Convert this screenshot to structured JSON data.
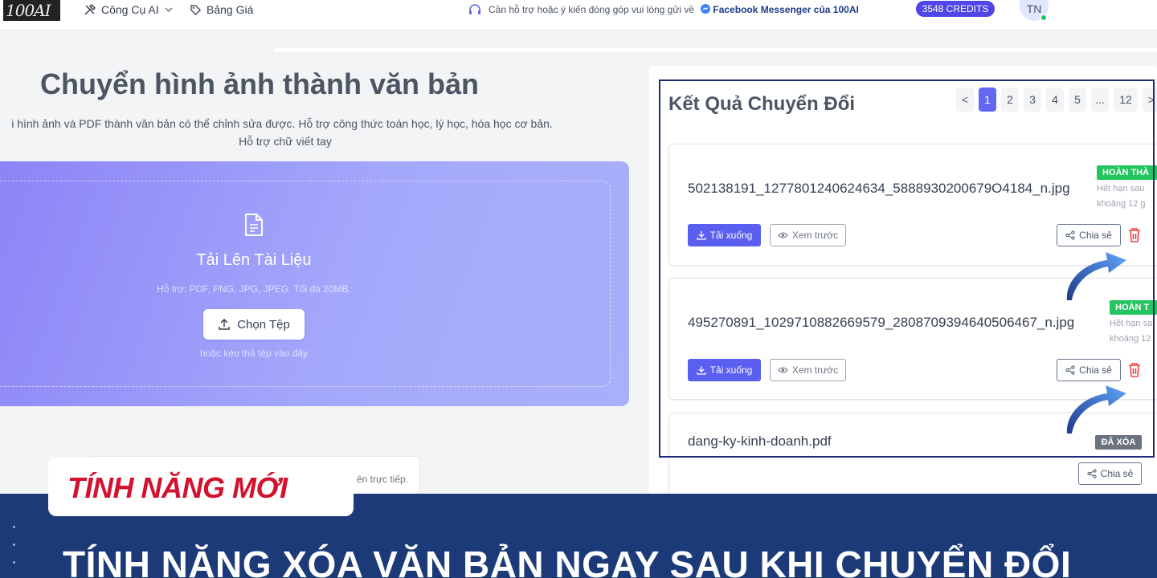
{
  "header": {
    "logo_text": "100AI",
    "nav": [
      {
        "label": "Công Cụ AI",
        "icon": "tools-icon",
        "has_dropdown": true
      },
      {
        "label": "Bảng Giá",
        "icon": "tag-icon"
      }
    ],
    "support_text": "Cần hỗ trợ hoặc ý kiến đóng góp vui lòng gửi về",
    "support_link": "Facebook Messenger của 100AI",
    "credits": "3548 CREDITS",
    "avatar_initials": "TN"
  },
  "main": {
    "title": "Chuyển hình ảnh thành văn bản",
    "subtitle_line1": "i hình ảnh và PDF thành văn bản có thể chỉnh sửa được. Hỗ trợ công thức toán học, lý học, hóa học cơ bản.",
    "subtitle_line2": "Hỗ trợ chữ viết tay",
    "upload": {
      "title": "Tải Lên Tài Liệu",
      "hint": "Hỗ trợ: PDF, PNG, JPG, JPEG. Tối đa 20MB.",
      "choose_label": "Chọn Tệp",
      "drag_hint": "hoặc kéo thả tệp vào đây"
    },
    "note_text": "ên trực tiếp."
  },
  "results": {
    "title": "Kết Quả Chuyển Đổi",
    "pagination": [
      "<",
      "1",
      "2",
      "3",
      "4",
      "5",
      "...",
      "12",
      ">"
    ],
    "active_page": "1",
    "items": [
      {
        "file_name": "502138191_1277801240624634_5888930200679O4184_n.jpg",
        "status": "HOÀN THÀ",
        "expire_line1": "Hết hạn sau",
        "expire_line2": "khoảng 12 g",
        "download_label": "Tải xuống",
        "preview_label": "Xem trước",
        "share_label": "Chia sẻ"
      },
      {
        "file_name": "495270891_1029710882669579_2808709394640506467_n.jpg",
        "status": "HOÀN T",
        "expire_line1": "Hết hạn sa",
        "expire_line2": "khoảng 12",
        "download_label": "Tải xuống",
        "preview_label": "Xem trước",
        "share_label": "Chia sẻ"
      },
      {
        "file_name": "dang-ky-kinh-doanh.pdf",
        "status": "ĐÃ XÓA",
        "share_label": "Chia sẻ"
      }
    ]
  },
  "banner": {
    "tag": "TÍNH NĂNG MỚI",
    "headline": "TÍNH NĂNG XÓA VĂN BẢN NGAY SAU KHI CHUYỂN ĐỔI"
  },
  "colors": {
    "accent": "#6366f1",
    "success": "#22c55e",
    "danger": "#ef4444",
    "banner_bg": "#1c3a78",
    "tag_red": "#d2122e"
  }
}
